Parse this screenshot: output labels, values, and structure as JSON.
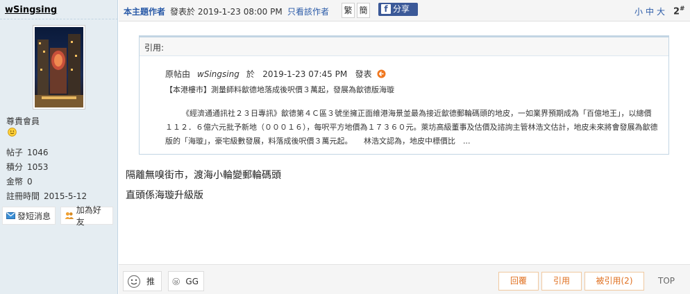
{
  "author": {
    "name": "wSingsing",
    "rank": "尊貴會員",
    "rank_icon": "smiley-face-icon",
    "stats": [
      {
        "label": "帖子",
        "value": "1046"
      },
      {
        "label": "積分",
        "value": "1053"
      },
      {
        "label": "金幣",
        "value": "0"
      },
      {
        "label": "註冊時間",
        "value": "2015-5-12"
      }
    ],
    "buttons": {
      "message": "發短消息",
      "add_friend": "加為好友"
    }
  },
  "meta": {
    "author_tag": "本主題作者",
    "posted": "發表於 2019-1-23 08:00 PM",
    "only_author": "只看該作者",
    "traditional": "繁",
    "simplified": "簡",
    "share": "分享",
    "font_small": "小",
    "font_medium": "中",
    "font_large": "大",
    "floor": "2",
    "floor_mark": "#"
  },
  "quote": {
    "head": "引用:",
    "origin_prefix": "原帖由",
    "origin_user": "wSingsing",
    "origin_at": "於",
    "origin_time": "2019-1-23  07:45  PM",
    "origin_suffix": "發表",
    "title": "【本港樓市】測量師料歙德地落成後呎價３萬起，發展為歙德版海璇",
    "body": "《經濟通通訊社２３日專訊》歙德第４Ｃ區３號坐擁正面維港海景並最為接近歙德郵輪碼頭的地皮，一如業界預期成為「百億地王」，以總價１１２．６億六元批予新地（０００１６），每呎平方地價為１７３６０元。萊坊高級董事及估價及諮詢主管林浩文估計，地皮未來將會發展為歙德版的「海璇」，豪宅級數發展，料落成後呎價３萬元起。　　林浩文認為，地皮中標價比　..."
  },
  "post": {
    "line1": "隔離無嗅街市，渡海小輪變郵輪碼頭",
    "line2": "直頭係海璇升級版"
  },
  "actions": {
    "recommend": "推",
    "gg": "GG",
    "reply": "回覆",
    "quote": "引用",
    "quoted": "被引用(2)",
    "top": "TOP"
  },
  "colors": {
    "link": "#2b5ba8",
    "sidebar": "#e5edf2",
    "action_orange": "#e07020",
    "facebook": "#3b5998"
  }
}
